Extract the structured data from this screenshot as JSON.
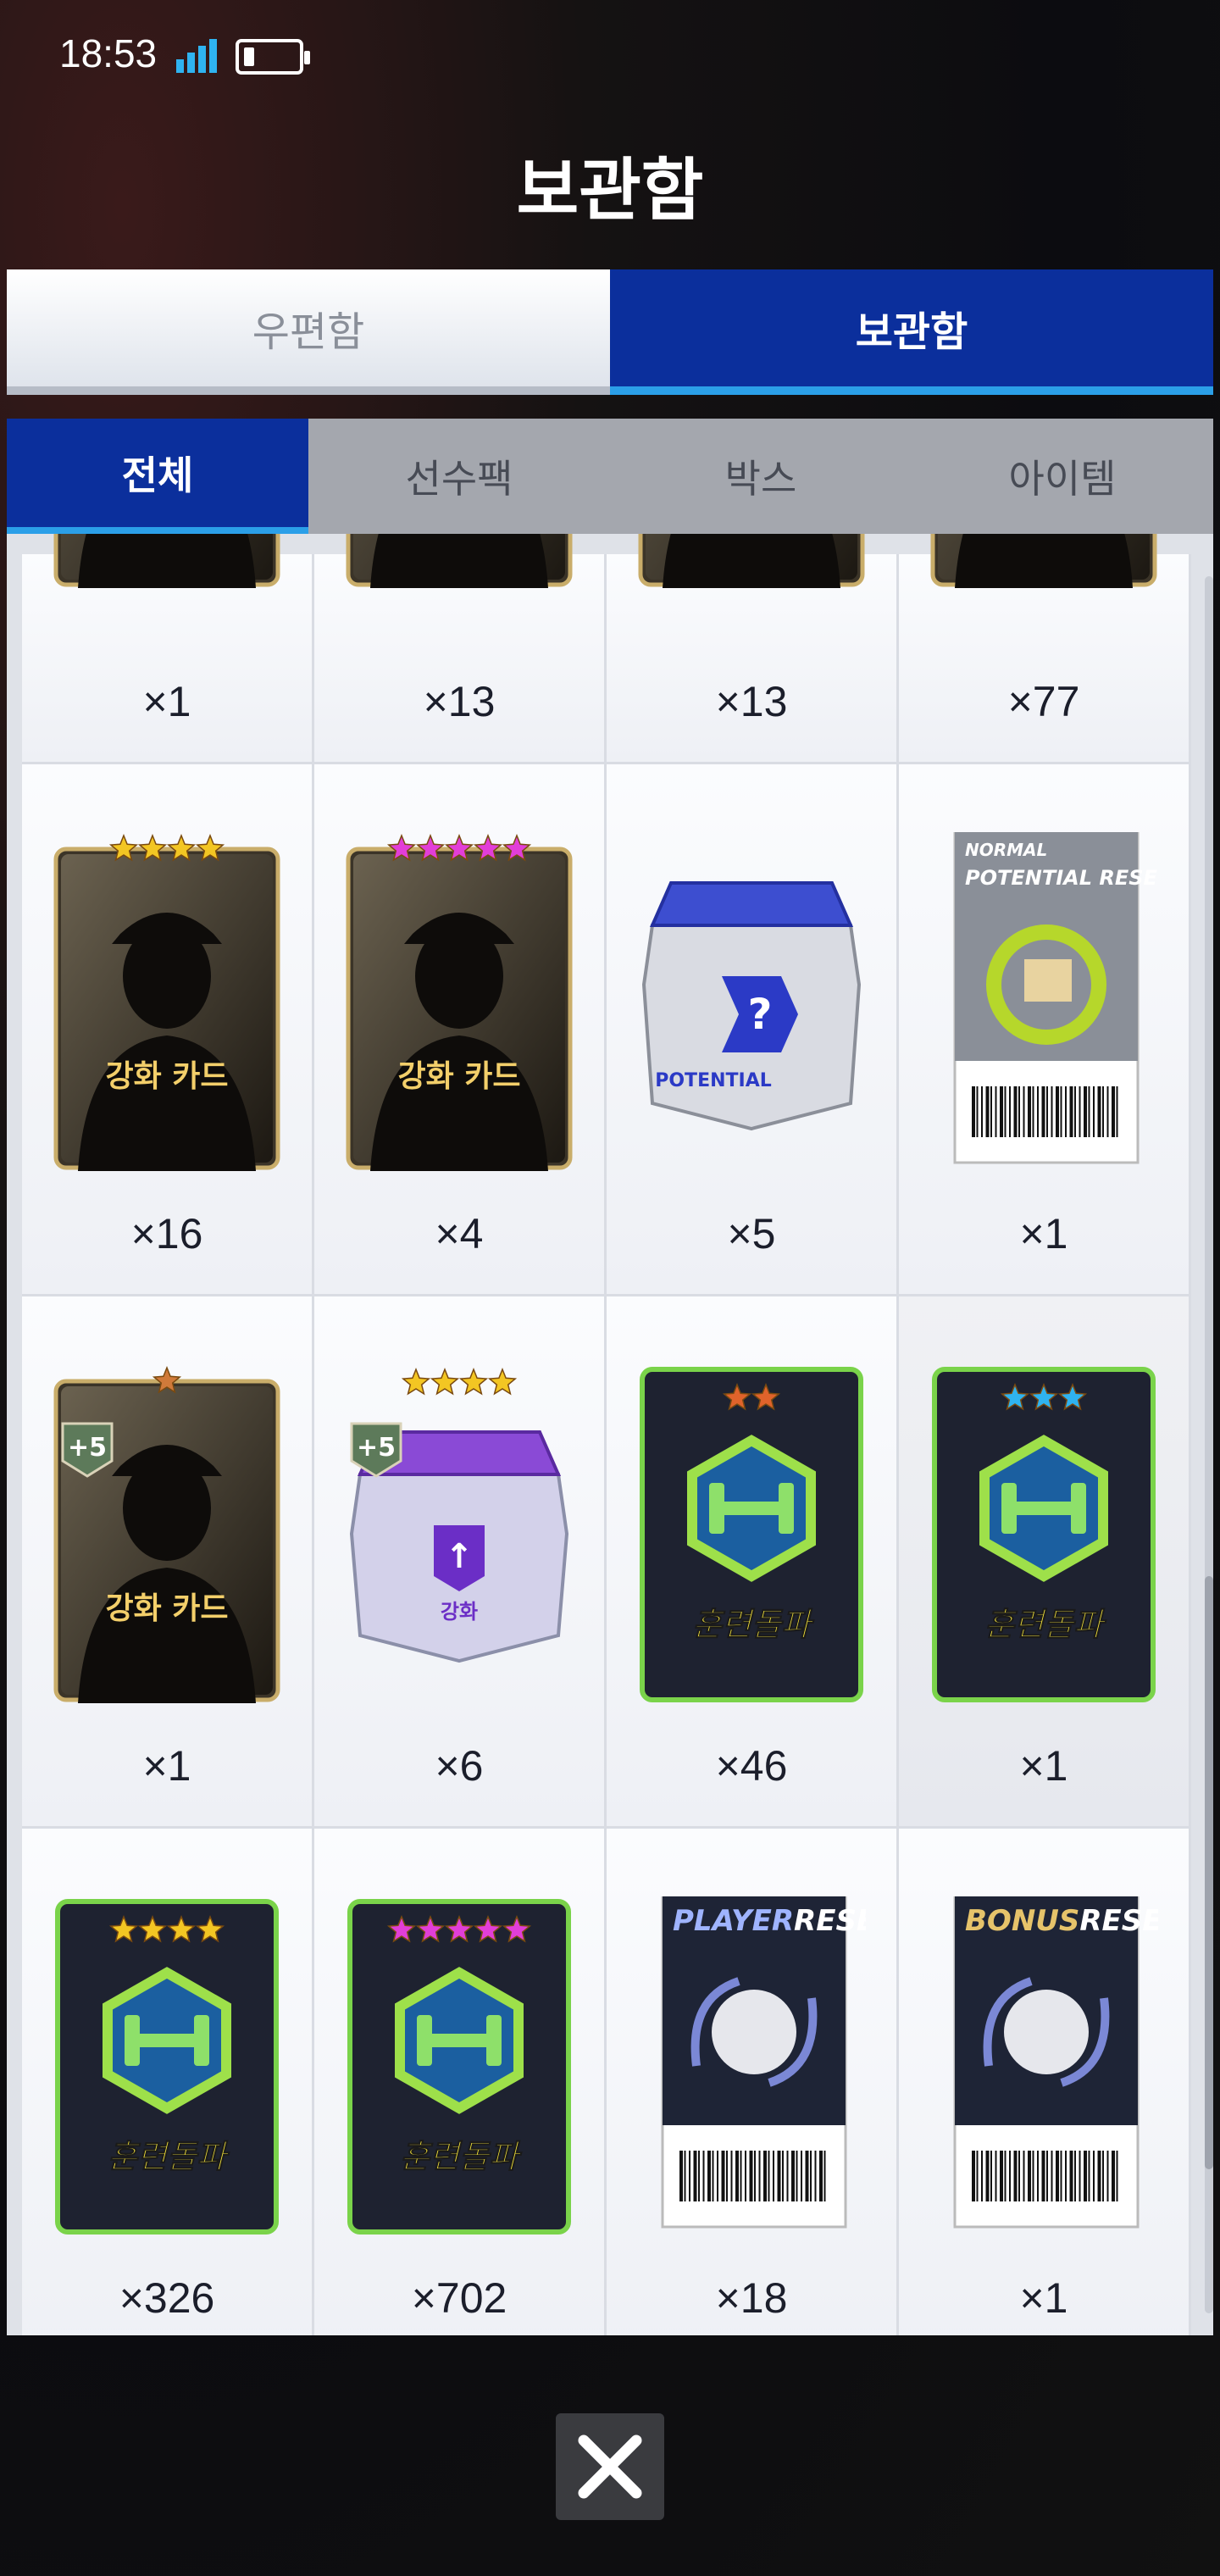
{
  "status": {
    "time": "18:53"
  },
  "title": "보관함",
  "top_tabs": [
    {
      "label": "우편함",
      "active": false
    },
    {
      "label": "보관함",
      "active": true
    }
  ],
  "sub_tabs": [
    {
      "label": "전체",
      "active": true
    },
    {
      "label": "선수팩",
      "active": false
    },
    {
      "label": "박스",
      "active": false
    },
    {
      "label": "아이템",
      "active": false
    }
  ],
  "items": [
    {
      "type": "partial",
      "count": "×1"
    },
    {
      "type": "partial",
      "count": "×13"
    },
    {
      "type": "partial",
      "count": "×13"
    },
    {
      "type": "partial",
      "count": "×77"
    },
    {
      "type": "upgrade-card",
      "stars": 4,
      "star_color": "#f3c623",
      "label": "강화 카드",
      "count": "×16"
    },
    {
      "type": "upgrade-card",
      "stars": 5,
      "star_color": "#e23ed8",
      "label": "강화 카드",
      "count": "×4"
    },
    {
      "type": "potential-box",
      "label": "POTENTIAL",
      "count": "×5"
    },
    {
      "type": "reset-ticket",
      "label_top": "NORMAL",
      "label": "POTENTIAL RESET",
      "count": "×1"
    },
    {
      "type": "upgrade-card-plus",
      "stars": 1,
      "star_color": "#d07a3a",
      "badge": "+5",
      "label": "강화 카드",
      "count": "×1"
    },
    {
      "type": "upgrade-box",
      "stars": 4,
      "star_color": "#f3c623",
      "badge": "+5",
      "label": "강화",
      "count": "×6"
    },
    {
      "type": "training",
      "stars": 2,
      "star_color": "#e0632b",
      "label": "훈련돌파",
      "count": "×46"
    },
    {
      "type": "training",
      "stars": 3,
      "star_color": "#2fb3f0",
      "label": "훈련돌파",
      "count": "×1",
      "highlight": true
    },
    {
      "type": "training",
      "stars": 4,
      "star_color": "#f3c623",
      "label": "훈련돌파",
      "count": "×326"
    },
    {
      "type": "training",
      "stars": 5,
      "star_color": "#e23ed8",
      "label": "훈련돌파",
      "count": "×702"
    },
    {
      "type": "player-reset",
      "label_a": "PLAYER",
      "label_b": "RESET",
      "count": "×18"
    },
    {
      "type": "bonus-reset",
      "label_a": "BONUS",
      "label_b": "RESET",
      "count": "×1"
    }
  ],
  "colors": {
    "accent": "#0b2f9c",
    "accent_line": "#2b9fe8"
  },
  "icons": {
    "close": "close-icon"
  }
}
